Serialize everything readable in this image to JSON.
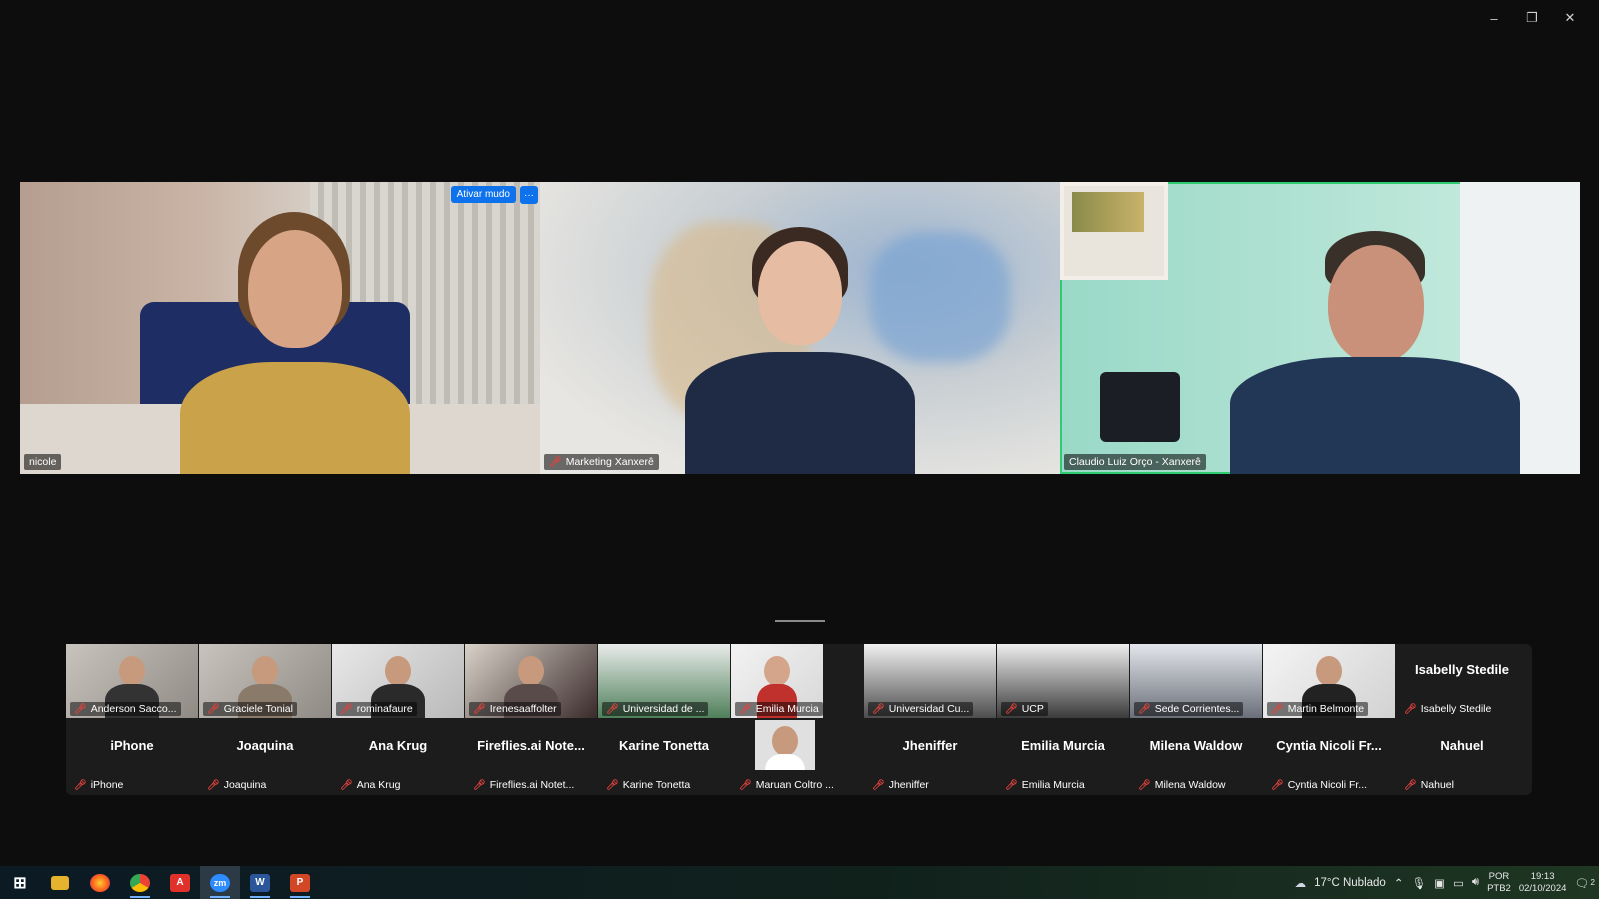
{
  "window": {
    "controls": [
      "–",
      "❐",
      "✕"
    ]
  },
  "main_tiles": [
    {
      "name": "nicole",
      "muted": false,
      "unmute_label": "Ativar mudo",
      "more_label": "···"
    },
    {
      "name": "Marketing Xanxerê",
      "muted": true
    },
    {
      "name": "Claudio Luiz Orço - Xanxerê",
      "muted": false,
      "active_speaker": true
    }
  ],
  "gallery_row1": [
    {
      "name": "Anderson Sacco...",
      "video": true
    },
    {
      "name": "Graciele Tonial",
      "video": true
    },
    {
      "name": "rominafaure",
      "video": true
    },
    {
      "name": "Irenesaaffolter",
      "video": true
    },
    {
      "name": "Universidad de ...",
      "video": true
    },
    {
      "name": "Emilia Murcia",
      "video": true
    },
    {
      "name": "Universidad Cu...",
      "video": true
    },
    {
      "name": "UCP",
      "video": true
    },
    {
      "name": "Sede Corrientes...",
      "video": true
    },
    {
      "name": "Martin Belmonte",
      "video": true
    },
    {
      "name": "Isabelly Stedile",
      "video": false,
      "display": "Isabelly Stedile"
    }
  ],
  "gallery_row2": [
    {
      "display": "iPhone",
      "name": "iPhone"
    },
    {
      "display": "Joaquina",
      "name": "Joaquina"
    },
    {
      "display": "Ana Krug",
      "name": "Ana Krug"
    },
    {
      "display": "Fireflies.ai  Note...",
      "name": "Fireflies.ai Notet..."
    },
    {
      "display": "Karine Tonetta",
      "name": "Karine Tonetta"
    },
    {
      "display": "",
      "name": "Maruan Coltro ...",
      "video": true
    },
    {
      "display": "Jheniffer",
      "name": "Jheniffer"
    },
    {
      "display": "Emilia Murcia",
      "name": "Emilia Murcia"
    },
    {
      "display": "Milena Waldow",
      "name": "Milena Waldow"
    },
    {
      "display": "Cyntia  Nicoli  Fr...",
      "name": "Cyntia Nicoli Fr..."
    },
    {
      "display": "Nahuel",
      "name": "Nahuel"
    }
  ],
  "taskbar": {
    "apps": [
      "windows-start",
      "file-explorer",
      "firefox",
      "chrome",
      "acrobat",
      "zoom",
      "word",
      "powerpoint"
    ],
    "zoom_label": "zm",
    "word_label": "W",
    "ppt_label": "P",
    "acrobat_label": "A",
    "weather": "17°C  Nublado",
    "lang_top": "POR",
    "lang_bottom": "PTB2",
    "time": "19:13",
    "date": "02/10/2024",
    "notifications": "2"
  },
  "colors": {
    "accent": "#0e72ed",
    "active_border": "#2ecc71",
    "muted_mic": "#e0433e"
  }
}
